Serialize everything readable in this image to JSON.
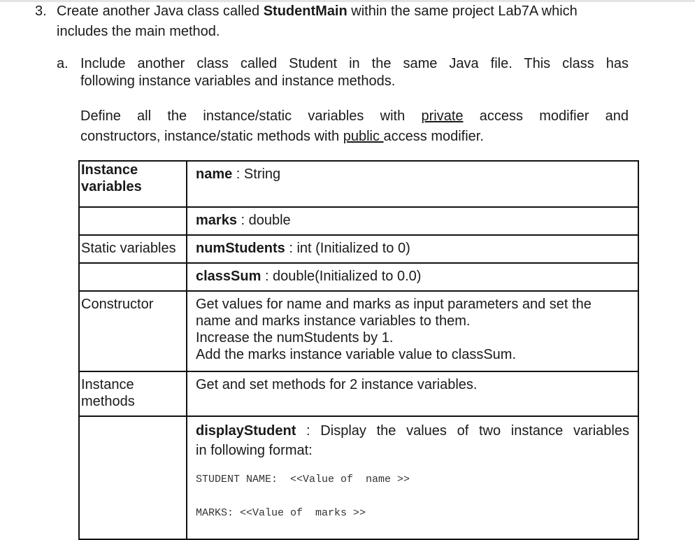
{
  "step": {
    "number": "3.",
    "line1_pre": "Create another Java class called ",
    "line1_bold": "StudentMain",
    "line1_post": " within the same project Lab7A which",
    "line2": "includes the main method."
  },
  "sub_a": {
    "marker": "a.",
    "line1": "Include another class called Student in the same Java file. This class has",
    "line2": "following instance variables and instance methods."
  },
  "define": {
    "line1_pre": "Define all the instance/static variables with ",
    "line1_u": "private",
    "line1_post": " access modifier and",
    "line2_pre": "constructors, instance/static methods with ",
    "line2_u": "public ",
    "line2_post": "access modifier."
  },
  "table": {
    "rows": [
      {
        "label": "Instance variables",
        "label_bold": true,
        "term": "name",
        "desc": " : String"
      },
      {
        "label": "",
        "term": "marks",
        "desc": " : double"
      },
      {
        "label": "Static variables",
        "term": "numStudents",
        "desc": " : int (Initialized to 0)"
      },
      {
        "label": "",
        "term": "classSum",
        "desc": " : double(Initialized to 0.0)"
      },
      {
        "label": "Constructor",
        "lines": [
          "Get values for name and marks as input parameters and set the",
          "name and marks instance variables to them.",
          "Increase the numStudents by 1.",
          "Add the marks instance variable value to classSum."
        ]
      },
      {
        "label": "Instance methods",
        "text": "Get and set methods for 2 instance variables."
      },
      {
        "label": "",
        "term": "displayStudent",
        "desc": " : Display the values of two instance variables",
        "desc2": "in following format:",
        "format_line1": "STUDENT NAME:  <<Value of  name >>",
        "format_line2": "MARKS: <<Value of  marks >>"
      }
    ]
  }
}
